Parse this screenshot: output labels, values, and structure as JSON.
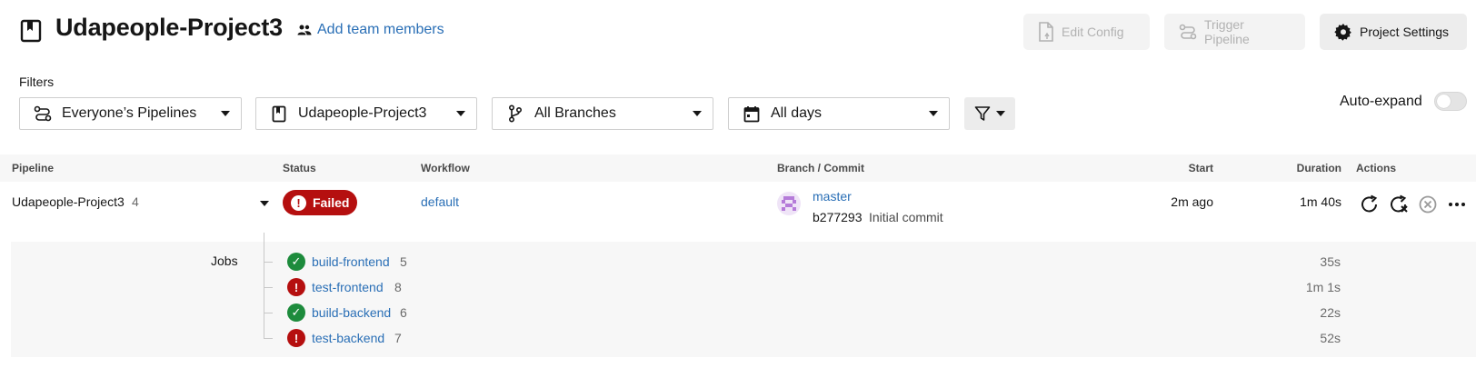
{
  "header": {
    "project_title": "Udapeople-Project3",
    "add_team_label": "Add team members",
    "edit_config_label": "Edit Config",
    "trigger_pipeline_label": "Trigger Pipeline",
    "project_settings_label": "Project Settings"
  },
  "filters": {
    "label": "Filters",
    "pipelines": "Everyone’s Pipelines",
    "project": "Udapeople-Project3",
    "branches": "All Branches",
    "days": "All days",
    "auto_expand_label": "Auto-expand",
    "auto_expand_on": false
  },
  "table": {
    "columns": {
      "pipeline": "Pipeline",
      "status": "Status",
      "workflow": "Workflow",
      "branch_commit": "Branch / Commit",
      "start": "Start",
      "duration": "Duration",
      "actions": "Actions"
    },
    "row": {
      "pipeline_name": "Udapeople-Project3",
      "pipeline_number": "4",
      "status": "Failed",
      "workflow": "default",
      "branch": "master",
      "commit_hash": "b277293",
      "commit_message": "Initial commit",
      "start": "2m ago",
      "duration": "1m 40s"
    },
    "jobs_label": "Jobs",
    "jobs": [
      {
        "name": "build-frontend",
        "number": "5",
        "status": "success",
        "duration": "35s"
      },
      {
        "name": "test-frontend",
        "number": "8",
        "status": "failed",
        "duration": "1m 1s"
      },
      {
        "name": "build-backend",
        "number": "6",
        "status": "success",
        "duration": "22s"
      },
      {
        "name": "test-backend",
        "number": "7",
        "status": "failed",
        "duration": "52s"
      }
    ]
  },
  "colors": {
    "link": "#2a6fb6",
    "failed": "#b50f0f",
    "success": "#1d8b3c"
  },
  "icons": {
    "project": "bookmark-icon",
    "team": "people-icon",
    "edit_config": "file-icon",
    "trigger": "pipeline-icon",
    "settings": "gear-icon",
    "filter": "funnel-icon",
    "branch": "branch-icon",
    "calendar": "calendar-icon",
    "rerun": "rerun-icon",
    "rerun_failed": "rerun-failed-icon",
    "cancel": "cancel-icon",
    "more": "more-icon"
  }
}
